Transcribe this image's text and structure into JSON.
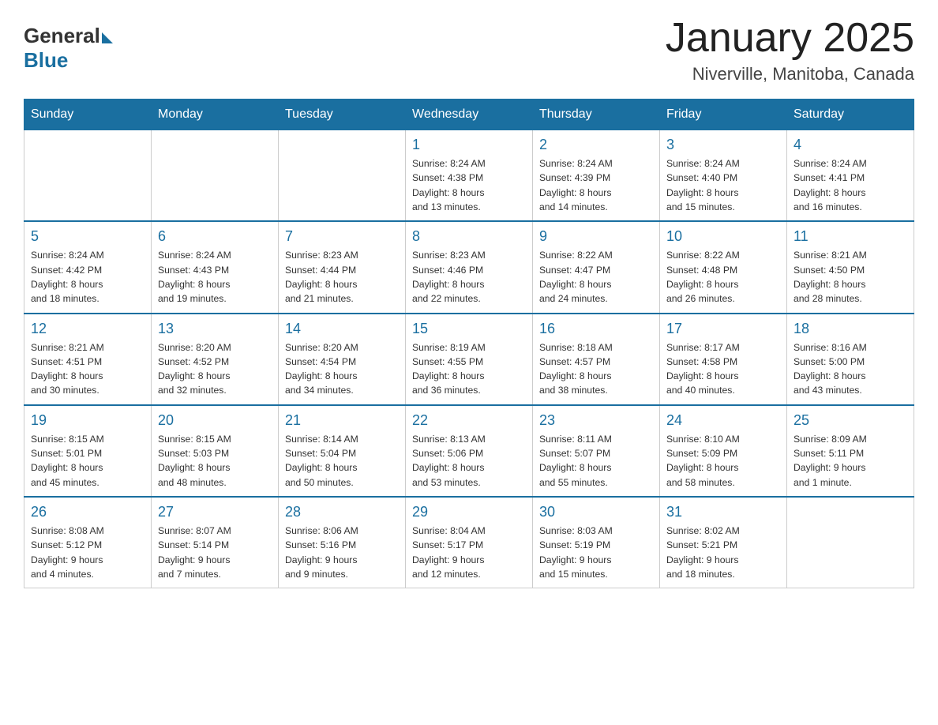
{
  "header": {
    "logo_general": "General",
    "logo_blue": "Blue",
    "title": "January 2025",
    "subtitle": "Niverville, Manitoba, Canada"
  },
  "days_of_week": [
    "Sunday",
    "Monday",
    "Tuesday",
    "Wednesday",
    "Thursday",
    "Friday",
    "Saturday"
  ],
  "weeks": [
    [
      {
        "day": "",
        "info": ""
      },
      {
        "day": "",
        "info": ""
      },
      {
        "day": "",
        "info": ""
      },
      {
        "day": "1",
        "info": "Sunrise: 8:24 AM\nSunset: 4:38 PM\nDaylight: 8 hours\nand 13 minutes."
      },
      {
        "day": "2",
        "info": "Sunrise: 8:24 AM\nSunset: 4:39 PM\nDaylight: 8 hours\nand 14 minutes."
      },
      {
        "day": "3",
        "info": "Sunrise: 8:24 AM\nSunset: 4:40 PM\nDaylight: 8 hours\nand 15 minutes."
      },
      {
        "day": "4",
        "info": "Sunrise: 8:24 AM\nSunset: 4:41 PM\nDaylight: 8 hours\nand 16 minutes."
      }
    ],
    [
      {
        "day": "5",
        "info": "Sunrise: 8:24 AM\nSunset: 4:42 PM\nDaylight: 8 hours\nand 18 minutes."
      },
      {
        "day": "6",
        "info": "Sunrise: 8:24 AM\nSunset: 4:43 PM\nDaylight: 8 hours\nand 19 minutes."
      },
      {
        "day": "7",
        "info": "Sunrise: 8:23 AM\nSunset: 4:44 PM\nDaylight: 8 hours\nand 21 minutes."
      },
      {
        "day": "8",
        "info": "Sunrise: 8:23 AM\nSunset: 4:46 PM\nDaylight: 8 hours\nand 22 minutes."
      },
      {
        "day": "9",
        "info": "Sunrise: 8:22 AM\nSunset: 4:47 PM\nDaylight: 8 hours\nand 24 minutes."
      },
      {
        "day": "10",
        "info": "Sunrise: 8:22 AM\nSunset: 4:48 PM\nDaylight: 8 hours\nand 26 minutes."
      },
      {
        "day": "11",
        "info": "Sunrise: 8:21 AM\nSunset: 4:50 PM\nDaylight: 8 hours\nand 28 minutes."
      }
    ],
    [
      {
        "day": "12",
        "info": "Sunrise: 8:21 AM\nSunset: 4:51 PM\nDaylight: 8 hours\nand 30 minutes."
      },
      {
        "day": "13",
        "info": "Sunrise: 8:20 AM\nSunset: 4:52 PM\nDaylight: 8 hours\nand 32 minutes."
      },
      {
        "day": "14",
        "info": "Sunrise: 8:20 AM\nSunset: 4:54 PM\nDaylight: 8 hours\nand 34 minutes."
      },
      {
        "day": "15",
        "info": "Sunrise: 8:19 AM\nSunset: 4:55 PM\nDaylight: 8 hours\nand 36 minutes."
      },
      {
        "day": "16",
        "info": "Sunrise: 8:18 AM\nSunset: 4:57 PM\nDaylight: 8 hours\nand 38 minutes."
      },
      {
        "day": "17",
        "info": "Sunrise: 8:17 AM\nSunset: 4:58 PM\nDaylight: 8 hours\nand 40 minutes."
      },
      {
        "day": "18",
        "info": "Sunrise: 8:16 AM\nSunset: 5:00 PM\nDaylight: 8 hours\nand 43 minutes."
      }
    ],
    [
      {
        "day": "19",
        "info": "Sunrise: 8:15 AM\nSunset: 5:01 PM\nDaylight: 8 hours\nand 45 minutes."
      },
      {
        "day": "20",
        "info": "Sunrise: 8:15 AM\nSunset: 5:03 PM\nDaylight: 8 hours\nand 48 minutes."
      },
      {
        "day": "21",
        "info": "Sunrise: 8:14 AM\nSunset: 5:04 PM\nDaylight: 8 hours\nand 50 minutes."
      },
      {
        "day": "22",
        "info": "Sunrise: 8:13 AM\nSunset: 5:06 PM\nDaylight: 8 hours\nand 53 minutes."
      },
      {
        "day": "23",
        "info": "Sunrise: 8:11 AM\nSunset: 5:07 PM\nDaylight: 8 hours\nand 55 minutes."
      },
      {
        "day": "24",
        "info": "Sunrise: 8:10 AM\nSunset: 5:09 PM\nDaylight: 8 hours\nand 58 minutes."
      },
      {
        "day": "25",
        "info": "Sunrise: 8:09 AM\nSunset: 5:11 PM\nDaylight: 9 hours\nand 1 minute."
      }
    ],
    [
      {
        "day": "26",
        "info": "Sunrise: 8:08 AM\nSunset: 5:12 PM\nDaylight: 9 hours\nand 4 minutes."
      },
      {
        "day": "27",
        "info": "Sunrise: 8:07 AM\nSunset: 5:14 PM\nDaylight: 9 hours\nand 7 minutes."
      },
      {
        "day": "28",
        "info": "Sunrise: 8:06 AM\nSunset: 5:16 PM\nDaylight: 9 hours\nand 9 minutes."
      },
      {
        "day": "29",
        "info": "Sunrise: 8:04 AM\nSunset: 5:17 PM\nDaylight: 9 hours\nand 12 minutes."
      },
      {
        "day": "30",
        "info": "Sunrise: 8:03 AM\nSunset: 5:19 PM\nDaylight: 9 hours\nand 15 minutes."
      },
      {
        "day": "31",
        "info": "Sunrise: 8:02 AM\nSunset: 5:21 PM\nDaylight: 9 hours\nand 18 minutes."
      },
      {
        "day": "",
        "info": ""
      }
    ]
  ]
}
